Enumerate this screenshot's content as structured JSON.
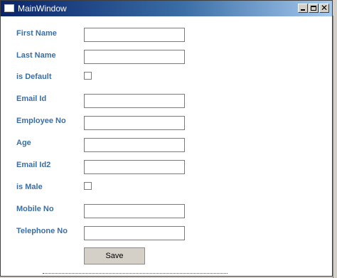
{
  "window": {
    "title": "MainWindow"
  },
  "title_buttons": {
    "min_icon": "minimize-icon",
    "max_icon": "maximize-icon",
    "close_glyph": "✕"
  },
  "form": {
    "first_name": {
      "label": "First Name",
      "value": ""
    },
    "last_name": {
      "label": "Last Name",
      "value": ""
    },
    "is_default": {
      "label": "is Default",
      "checked": false
    },
    "email_id": {
      "label": "Email Id",
      "value": ""
    },
    "employee_no": {
      "label": "Employee No",
      "value": ""
    },
    "age": {
      "label": "Age",
      "value": ""
    },
    "email_id2": {
      "label": "Email Id2",
      "value": ""
    },
    "is_male": {
      "label": "is Male",
      "checked": false
    },
    "mobile_no": {
      "label": "Mobile No",
      "value": ""
    },
    "telephone_no": {
      "label": "Telephone No",
      "value": ""
    }
  },
  "actions": {
    "save_label": "Save"
  },
  "colors": {
    "label": "#3a6ea5",
    "title_start": "#0a246a",
    "title_end": "#a6caf0"
  }
}
